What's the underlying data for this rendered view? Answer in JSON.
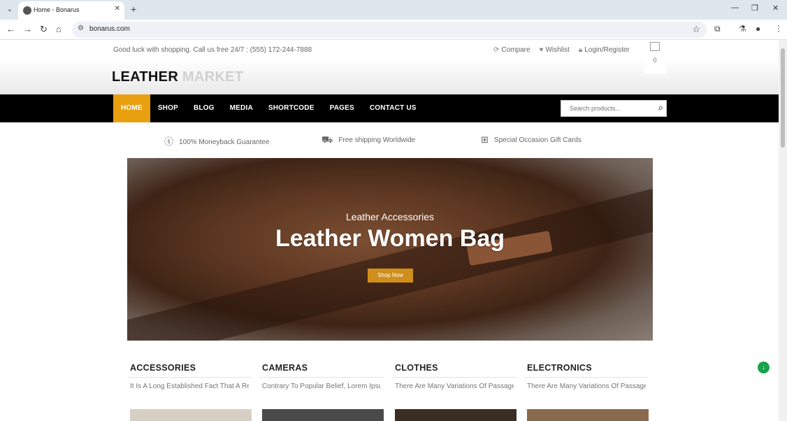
{
  "browser": {
    "tab_title": "Home - Bonarus",
    "url": "bonarus.com"
  },
  "header": {
    "promo": "Good luck with shopping. Call us free 24/7 : (555) 172-244-7888",
    "links": [
      {
        "icon": "refresh-icon",
        "label": "Compare"
      },
      {
        "icon": "heart-icon",
        "label": "Wishlist"
      },
      {
        "icon": "lock-icon",
        "label": "Login/Register"
      }
    ],
    "cart_count": "0",
    "logo_part1": "LEATHER",
    "logo_part2": "MARKET"
  },
  "nav": {
    "items": [
      "HOME",
      "SHOP",
      "BLOG",
      "MEDIA",
      "SHORTCODE",
      "PAGES",
      "CONTACT US"
    ],
    "active": "HOME",
    "search_placeholder": "Search products..."
  },
  "features": [
    {
      "icon": "dollar-icon",
      "label": "100% Moneyback Guarantee"
    },
    {
      "icon": "truck-icon",
      "label": "Free shipping Worldwide"
    },
    {
      "icon": "gift-icon",
      "label": "Special Occasion Gift Cards"
    }
  ],
  "hero": {
    "subtitle": "Leather Accessories",
    "title": "Leather Women Bag",
    "button": "Shop Now"
  },
  "categories": [
    {
      "title": "ACCESSORIES",
      "desc": "It Is A Long Established Fact That A Rea"
    },
    {
      "title": "CAMERAS",
      "desc": "Contrary To Popular Belief, Lorem Ipsu"
    },
    {
      "title": "CLOTHES",
      "desc": "There Are Many Variations Of Passages"
    },
    {
      "title": "ELECTRONICS",
      "desc": "There Are Many Variations Of Passages"
    }
  ],
  "colors": {
    "accent": "#e8a011",
    "nav_bg": "#000000",
    "button": "#d08f1a"
  }
}
